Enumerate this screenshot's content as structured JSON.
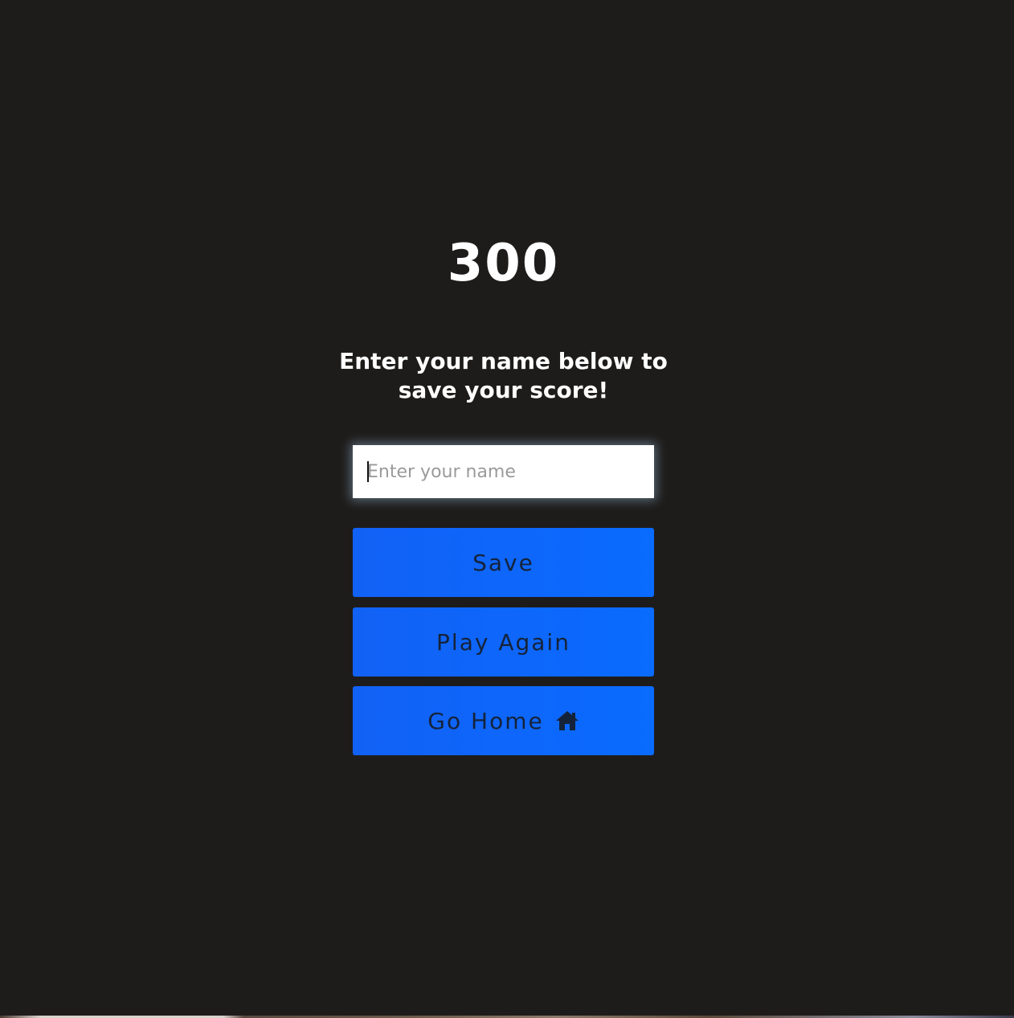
{
  "score": "300",
  "prompt": "Enter your name below to save your score!",
  "name_input": {
    "placeholder": "Enter your name",
    "value": ""
  },
  "buttons": {
    "save": "Save",
    "play_again": "Play Again",
    "go_home": "Go Home"
  },
  "icons": {
    "go_home": "home-icon"
  },
  "colors": {
    "background": "#1e1c1b",
    "button": "#0d66ff",
    "button_text": "#15233a",
    "text": "#ffffff"
  }
}
